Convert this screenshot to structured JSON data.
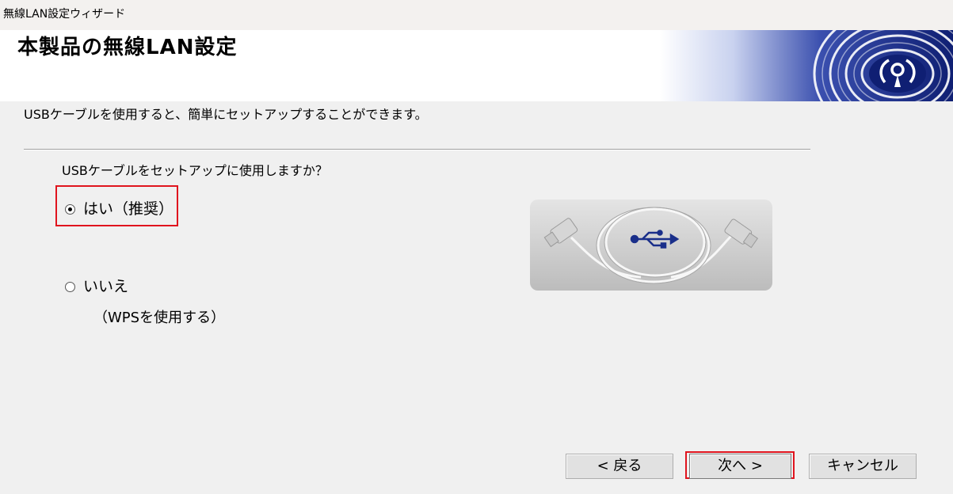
{
  "window": {
    "title": "無線LAN設定ウィザード"
  },
  "header": {
    "heading": "本製品の無線LAN設定",
    "logo_icon": "wireless-logo-icon"
  },
  "content": {
    "intro": "USBケーブルを使用すると、簡単にセットアップすることができます。",
    "question": "USBケーブルをセットアップに使用しますか？",
    "options": [
      {
        "label": "はい（推奨）",
        "selected": true
      },
      {
        "label": "いいえ",
        "sublabel": "（WPSを使用する）",
        "selected": false
      }
    ],
    "image_icon": "usb-cable-icon"
  },
  "buttons": {
    "back": "< 戻る",
    "next": "次へ >",
    "cancel": "キャンセル"
  },
  "colors": {
    "highlight": "#e0141e",
    "logo_blue": "#1a2f8a",
    "background": "#f0f0f0"
  }
}
